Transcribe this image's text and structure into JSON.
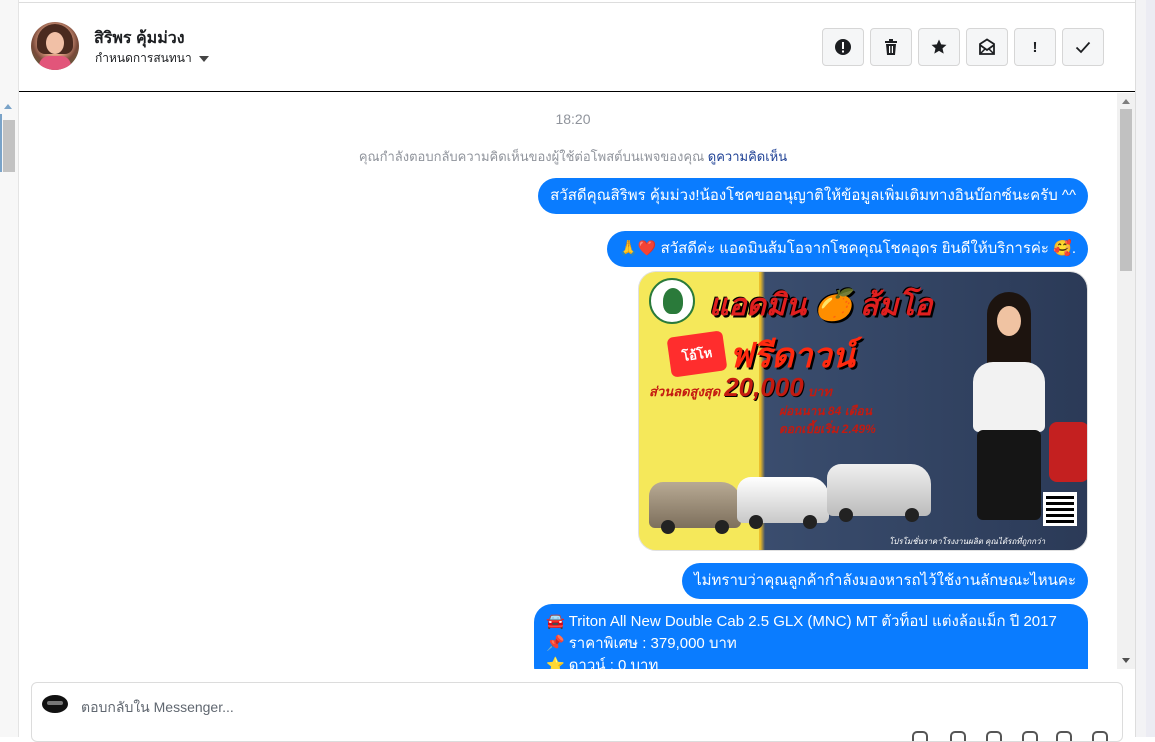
{
  "header": {
    "contact_name": "สิริพร คุ้มม่วง",
    "manage_label": "กำหนดการสนทนา",
    "toolbar": {
      "report_icon": "alert-circle-icon",
      "delete_icon": "trash-icon",
      "star_icon": "star-icon",
      "unread_icon": "envelope-icon",
      "important_label": "!",
      "done_icon": "checkmark-icon"
    }
  },
  "chat": {
    "timestamp": "18:20",
    "notice_text": "คุณกำลังตอบกลับความคิดเห็นของผู้ใช้ต่อโพสต์บนเพจของคุณ",
    "notice_link": "ดูความคิดเห็น",
    "messages": [
      {
        "text": "สวัสดีคุณสิริพร คุ้มม่วง!น้องโชคขออนุญาติให้ข้อมูลเพิ่มเติมทางอินบ๊อกซ์นะครับ ^^"
      },
      {
        "emoji_prefix": "🙏❤️",
        "text": "สวัสดีค่ะ แอดมินส้มโอจากโชคคุณโชคอุดร ยินดีให้บริการค่ะ",
        "emoji_suffix": "🥰."
      },
      {
        "text": "ไม่ทราบว่าคุณลูกค้ากำลังมองหารถไว้ใช้งานลักษณะไหนคะ"
      },
      {
        "lines": [
          {
            "emoji": "🚘",
            "text": "Triton All New Double Cab 2.5 GLX (MNC) MT ตัวท็อป แต่งล้อแม็ก ปี 2017"
          },
          {
            "emoji": "📌",
            "text": "ราคาพิเศษ : 379,000 บาท"
          },
          {
            "emoji": "⭐",
            "text": "ดาวน์ : 0 บาท"
          }
        ]
      }
    ],
    "promo_image": {
      "title": "แอดมิน 🍊 ส้มโอ",
      "badge": "โอ้โห",
      "headline": "ฟรีดาวน์",
      "discount_prefix": "ส่วนลดสูงสุด",
      "discount_amount": "20,000",
      "discount_unit": "บาท",
      "installment": "ผ่อนนาน 84 เดือน",
      "interest": "ดอกเบี้ยเริ่ม 2.49%",
      "footer": "โปรโมชั่นราคาโรงงานผลิต คุณได้รถที่ถูกกว่า"
    }
  },
  "composer": {
    "placeholder": "ตอบกลับใน Messenger..."
  }
}
